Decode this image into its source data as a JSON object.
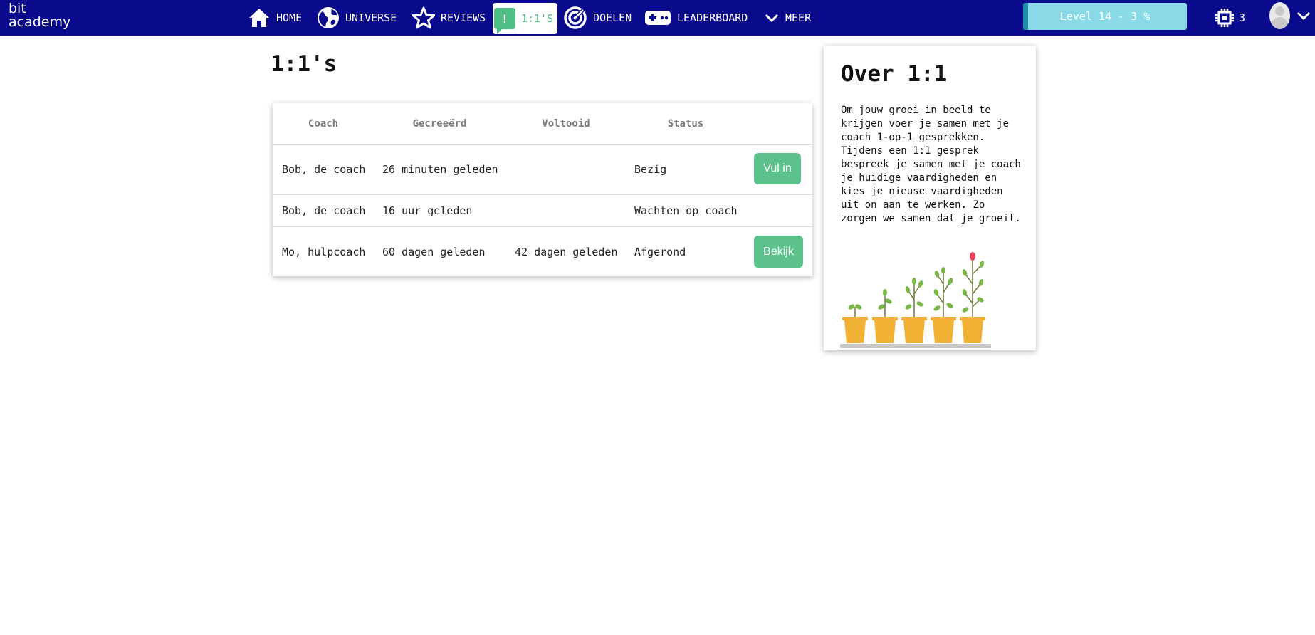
{
  "brand": {
    "line1": "bit",
    "line2": "academy"
  },
  "nav": {
    "home": "HOME",
    "universe": "UNIVERSE",
    "reviews": "REVIEWS",
    "one_on_ones": "1:1'S",
    "doelen": "DOELEN",
    "leaderboard": "LEADERBOARD",
    "meer": "MEER"
  },
  "level": {
    "label": "Level 14 - 3 %",
    "progress_percent": 3
  },
  "chips": {
    "count": "3"
  },
  "page": {
    "title": "1:1's"
  },
  "table": {
    "headers": [
      "Coach",
      "Gecreeërd",
      "Voltooid",
      "Status"
    ],
    "rows": [
      {
        "coach": "Bob, de coach",
        "created": "26 minuten geleden",
        "completed": "",
        "status": "Bezig",
        "action": "Vul in"
      },
      {
        "coach": "Bob, de coach",
        "created": "16 uur geleden",
        "completed": "",
        "status": "Wachten op coach",
        "action": ""
      },
      {
        "coach": "Mo, hulpcoach",
        "created": "60 dagen geleden",
        "completed": "42 dagen geleden",
        "status": "Afgerond",
        "action": "Bekijk"
      }
    ]
  },
  "about": {
    "title": "Over 1:1",
    "text": "Om jouw groei in beeld te krijgen voer je samen met je coach 1-op-1 gesprekken. Tijdens een 1:1 gesprek bespreek je samen met je coach je huidige vaardigheden en kies je nieuse vaardigheden uit on aan te werken. Zo zorgen we samen dat je groeit."
  },
  "colors": {
    "nav_bg": "#0a0a8c",
    "accent_green": "#5cc18b",
    "level_bg": "#8ad9e6",
    "level_fill": "#1a8fa6",
    "pot": "#f0b134"
  },
  "icons": [
    "home-icon",
    "globe-icon",
    "star-icon",
    "chat-alert-icon",
    "target-icon",
    "gamepad-icon",
    "chevron-down-icon",
    "chip-icon",
    "avatar"
  ]
}
